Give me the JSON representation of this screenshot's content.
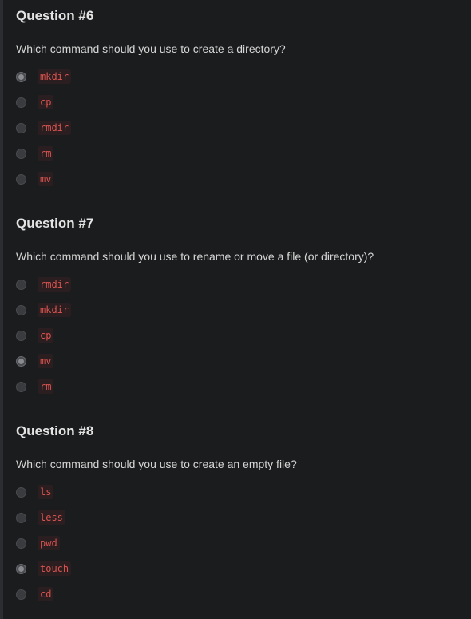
{
  "questions": [
    {
      "title": "Question #6",
      "text": "Which command should you use to create a directory?",
      "options": [
        {
          "label": "mkdir",
          "selected": true
        },
        {
          "label": "cp",
          "selected": false
        },
        {
          "label": "rmdir",
          "selected": false
        },
        {
          "label": "rm",
          "selected": false
        },
        {
          "label": "mv",
          "selected": false
        }
      ]
    },
    {
      "title": "Question #7",
      "text": "Which command should you use to rename or move a file (or directory)?",
      "options": [
        {
          "label": "rmdir",
          "selected": false
        },
        {
          "label": "mkdir",
          "selected": false
        },
        {
          "label": "cp",
          "selected": false
        },
        {
          "label": "mv",
          "selected": true
        },
        {
          "label": "rm",
          "selected": false
        }
      ]
    },
    {
      "title": "Question #8",
      "text": "Which command should you use to create an empty file?",
      "options": [
        {
          "label": "ls",
          "selected": false
        },
        {
          "label": "less",
          "selected": false
        },
        {
          "label": "pwd",
          "selected": false
        },
        {
          "label": "touch",
          "selected": true
        },
        {
          "label": "cd",
          "selected": false
        }
      ]
    }
  ],
  "colors": {
    "background": "#1b1c1e",
    "code_text": "#d9534f",
    "code_background": "#2a1e20"
  }
}
